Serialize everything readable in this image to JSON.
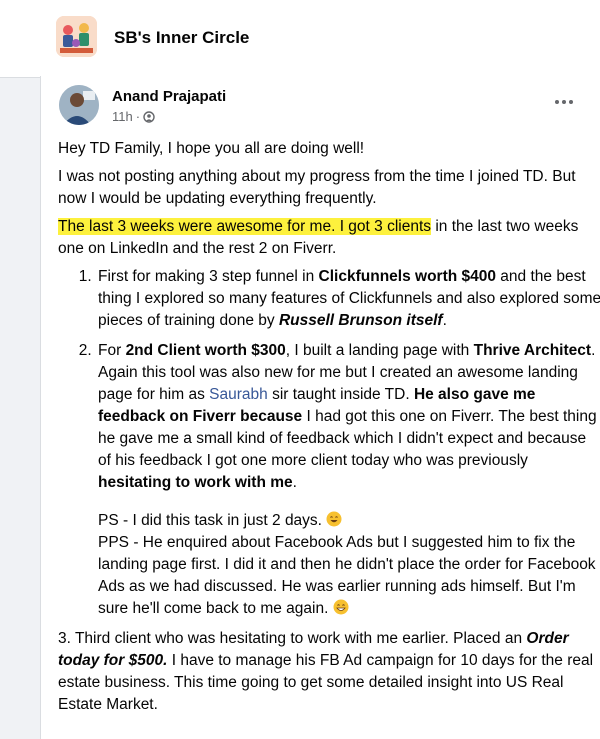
{
  "group": {
    "name": "SB's Inner Circle"
  },
  "post": {
    "author": "Anand Prajapati",
    "time": "11h",
    "sep": "·",
    "greeting": "Hey TD Family, I hope you all are doing well!",
    "intro": "I was not posting anything about my progress from the time I joined TD. But now I would be updating everything frequently.",
    "highlight": "The last 3 weeks were awesome for me. I got 3 clients",
    "highlight_rest": " in the last two weeks one on LinkedIn and the rest 2 on Fiverr.",
    "item1": {
      "t1": "First for making 3 step funnel in ",
      "b1": "Clickfunnels worth $400",
      "t2": " and the best thing I explored so many features of Clickfunnels and also explored some pieces of training done by ",
      "bi1": "Russell Brunson itself",
      "t3": "."
    },
    "item2": {
      "t1": "For ",
      "b1": "2nd Client worth $300",
      "t2": ", I built a landing page with ",
      "b2": "Thrive Architect",
      "t3": ". Again this tool was also new for me but I created an awesome landing page for him as ",
      "mention": "Saurabh",
      "t4": " sir taught inside TD. ",
      "b3": "He also gave me feedback on Fiverr because",
      "t5": " I had got this one on Fiverr. The best thing he gave me a small kind of feedback which I didn't expect and because of his feedback I got one more client today who was previously ",
      "b4": "hesitating to work with me",
      "t6": ".",
      "ps": "PS - I did this task in just 2 days.",
      "pps": "PPS - He enquired about Facebook Ads but I suggested him to fix the landing page first. I did it and then he didn't place the order for Facebook Ads as we had discussed. He was earlier running ads himself. But I'm sure he'll come back to me again."
    },
    "item3": {
      "t1": "3. Third client who was hesitating to work with me earlier. Placed an ",
      "bi1": "Order today for $500.",
      "t2": " I have to manage his FB Ad campaign for 10 days for the real estate business. This time going to get some detailed insight into US Real Estate Market."
    }
  }
}
